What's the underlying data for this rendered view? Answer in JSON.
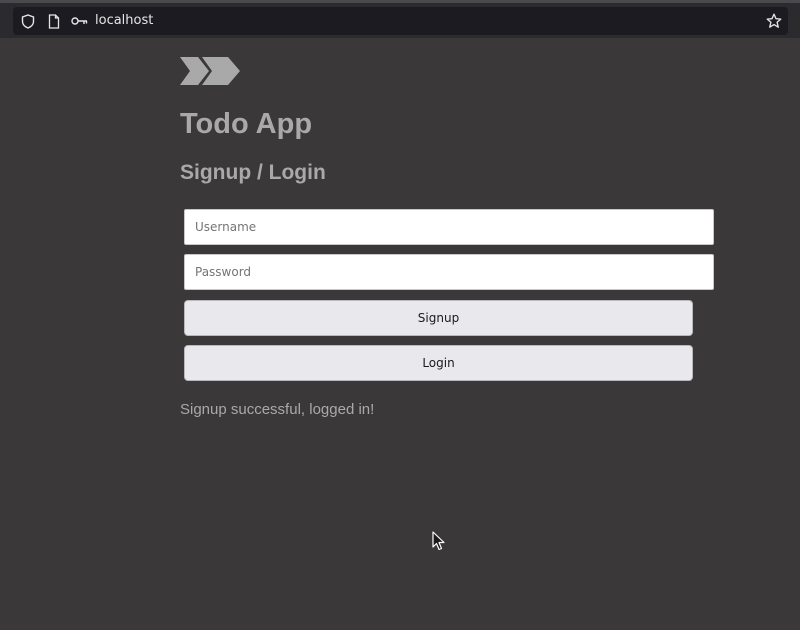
{
  "browser": {
    "url": "localhost",
    "icons": [
      "shield-icon",
      "page-icon",
      "key-icon",
      "star-icon"
    ]
  },
  "app": {
    "logo": "chevrons-logo-icon",
    "title": "Todo App",
    "section_title": "Signup / Login"
  },
  "form": {
    "username_placeholder": "Username",
    "username_value": "",
    "password_placeholder": "Password",
    "password_value": "",
    "signup_label": "Signup",
    "login_label": "Login"
  },
  "status": {
    "message": "Signup successful, logged in!"
  },
  "colors": {
    "page_background": "#3a3839",
    "heading_text": "#a9a9a9",
    "button_background": "#e9e9ed"
  }
}
